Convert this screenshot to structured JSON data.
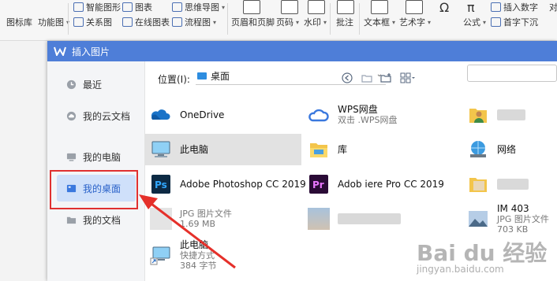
{
  "ribbon": {
    "items": [
      {
        "label": "图标库",
        "caret": "▾"
      },
      {
        "label": "功能图",
        "caret": "▾"
      },
      {
        "label": "智能图形"
      },
      {
        "label": "关系图"
      },
      {
        "label": "图表"
      },
      {
        "label": "在线图表"
      },
      {
        "label": "思维导图",
        "caret": "▾"
      },
      {
        "label": "流程图",
        "caret": "▾"
      },
      {
        "label": "页眉和页脚"
      },
      {
        "label": "页码",
        "caret": "▾"
      },
      {
        "label": "水印",
        "caret": "▾"
      },
      {
        "label": "批注"
      },
      {
        "label": "文本框",
        "caret": "▾"
      },
      {
        "label": "艺术字",
        "caret": "▾"
      },
      {
        "label": "公式",
        "caret": "▾"
      },
      {
        "label": "插入数字"
      },
      {
        "label": "首字下沉"
      },
      {
        "label": "对"
      }
    ],
    "symbols": {
      "omega": "Ω",
      "pi": "π"
    }
  },
  "dialog": {
    "title": "插入图片",
    "sidebar": [
      {
        "label": "最近",
        "icon": "clock-icon"
      },
      {
        "label": "我的云文档",
        "icon": "cloud-icon"
      },
      {
        "label": "我的电脑",
        "icon": "computer-icon"
      },
      {
        "label": "我的桌面",
        "icon": "desktop-icon",
        "active": true
      },
      {
        "label": "我的文档",
        "icon": "folder-icon"
      }
    ],
    "location_label": "位置(I):",
    "location_value": "桌面",
    "files": [
      {
        "name": "OneDrive",
        "icon": "onedrive-icon"
      },
      {
        "name": "WPS网盘",
        "sub": "双击 .WPS网盘",
        "icon": "wps-cloud-icon"
      },
      {
        "name": "",
        "icon": "user-folder-icon"
      },
      {
        "name": "此电脑",
        "icon": "computer-icon",
        "selected": true
      },
      {
        "name": "库",
        "icon": "library-folder-icon"
      },
      {
        "name": "网络",
        "icon": "network-icon"
      },
      {
        "name": "Adobe Photoshop CC 2019",
        "icon": "photoshop-icon"
      },
      {
        "name": "Adob iere Pro CC 2019",
        "icon": "premiere-icon"
      },
      {
        "name": "",
        "icon": "image-folder-icon"
      },
      {
        "name": "",
        "sub": "JPG 图片文件",
        "sub2": "1.69 MB",
        "icon": "image-file-icon"
      },
      {
        "name": "",
        "icon": "blurred-icon"
      },
      {
        "name": "IM 403",
        "sub": "JPG 图片文件",
        "sub2": "703 KB",
        "icon": "photo-thumb-icon"
      },
      {
        "name": "此电脑",
        "sub": "快捷方式",
        "sub2": "384 字节",
        "icon": "computer-shortcut-icon"
      }
    ]
  },
  "watermark": {
    "main": "Bai du 经验",
    "sub": "jingyan.baidu.com"
  }
}
